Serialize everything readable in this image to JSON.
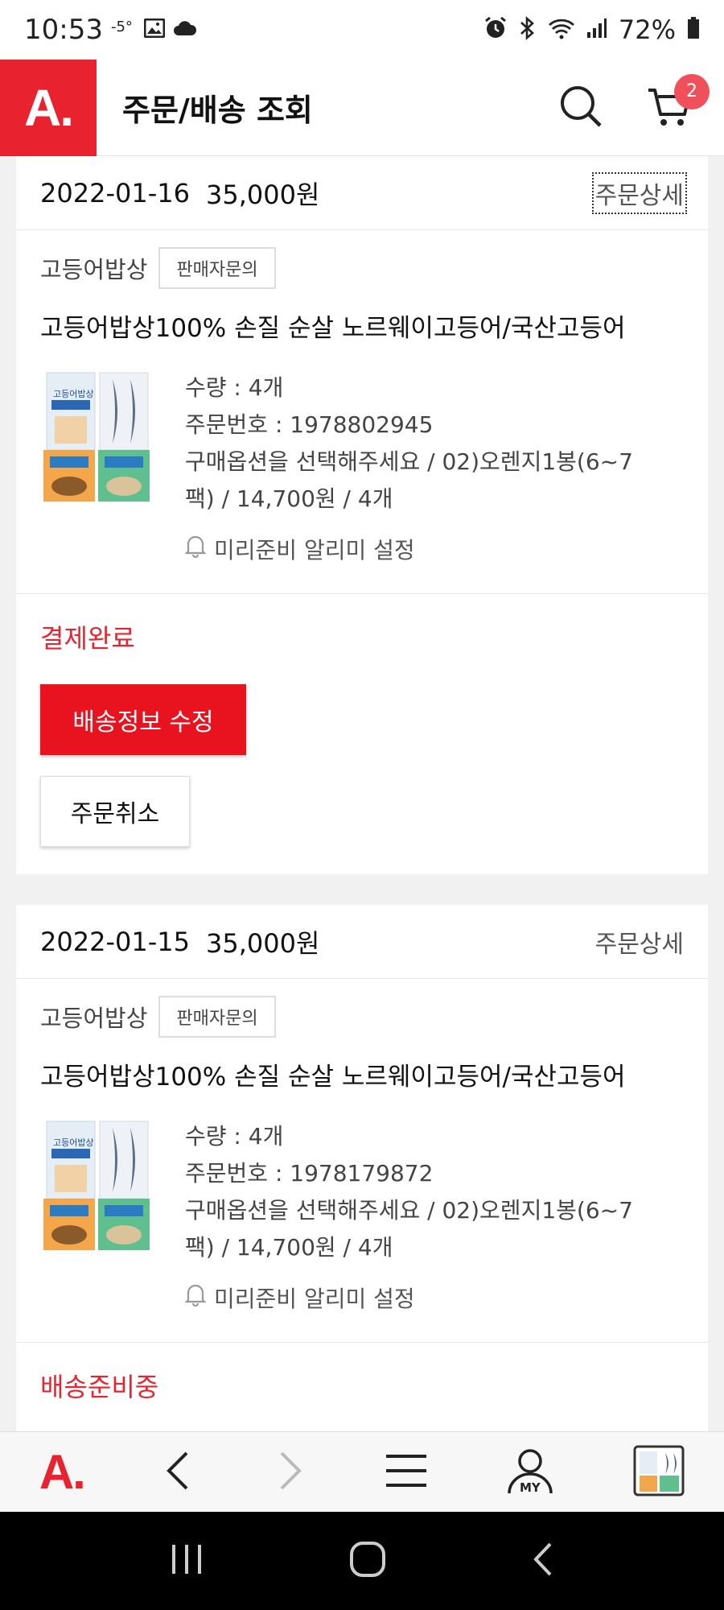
{
  "status_bar": {
    "time": "10:53",
    "temp": "-5°",
    "battery": "72%"
  },
  "header": {
    "logo": "A.",
    "title": "주문/배송 조회",
    "cart_count": "2"
  },
  "orders": [
    {
      "date": "2022-01-16",
      "price": "35,000원",
      "detail_label": "주문상세",
      "seller": "고등어밥상",
      "seller_inquiry": "판매자문의",
      "product_title": "고등어밥상100% 손질 순살 노르웨이고등어/국산고등어",
      "quantity": "수량 : 4개",
      "order_number": "주문번호 : 1978802945",
      "option_line1": "구매옵션을 선택해주세요 / 02)오렌지1봉(6~7",
      "option_line2": "팩) / 14,700원 / 4개",
      "alarm_label": "미리준비 알리미 설정",
      "status": "결제완료",
      "edit_shipping_label": "배송정보 수정",
      "cancel_label": "주문취소"
    },
    {
      "date": "2022-01-15",
      "price": "35,000원",
      "detail_label": "주문상세",
      "seller": "고등어밥상",
      "seller_inquiry": "판매자문의",
      "product_title": "고등어밥상100% 손질 순살 노르웨이고등어/국산고등어",
      "quantity": "수량 : 4개",
      "order_number": "주문번호 : 1978179872",
      "option_line1": "구매옵션을 선택해주세요 / 02)오렌지1봉(6~7",
      "option_line2": "팩) / 14,700원 / 4개",
      "alarm_label": "미리준비 알리미 설정",
      "status": "배송준비중"
    }
  ],
  "thumbnail_text": "고등어밥상",
  "bottom_nav": {
    "logo": "A.",
    "my_label": "MY"
  },
  "colors": {
    "brand_red": "#e8232f",
    "button_red": "#e8131f",
    "badge": "#f0505a"
  }
}
